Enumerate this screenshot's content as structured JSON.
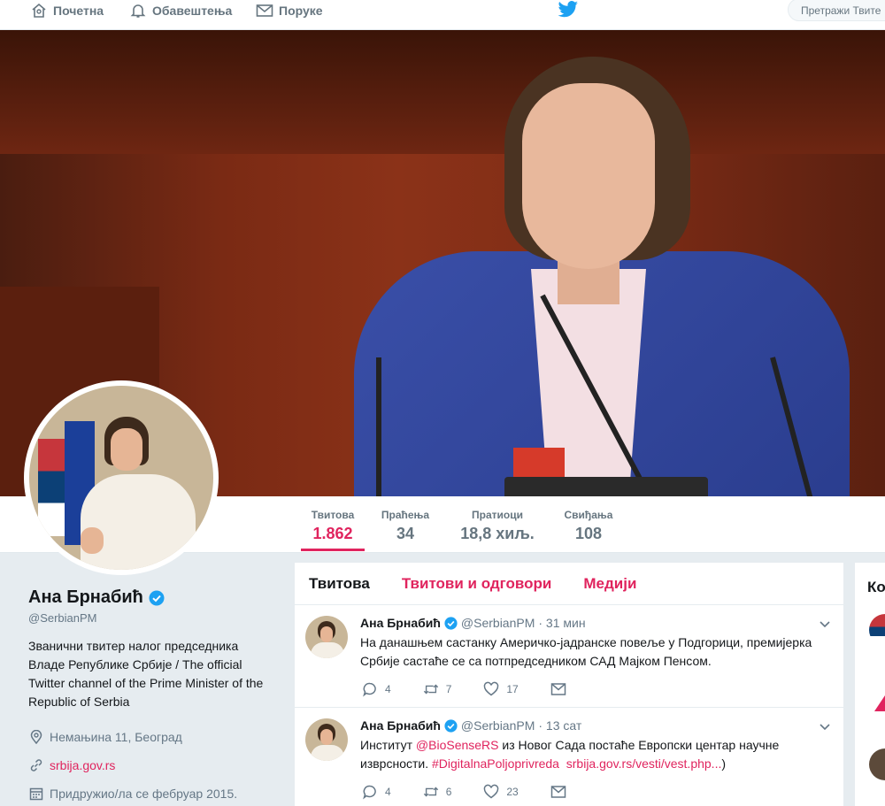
{
  "nav": {
    "home": "Почетна",
    "notifications": "Обавештења",
    "messages": "Поруке",
    "search_placeholder": "Претражи Твите"
  },
  "colors": {
    "accent": "#e0245e",
    "verified": "#1da1f2",
    "brand": "#1da1f2"
  },
  "stats": [
    {
      "label": "Твитова",
      "value": "1.862"
    },
    {
      "label": "Праћења",
      "value": "34"
    },
    {
      "label": "Пратиоци",
      "value": "18,8 хиљ."
    },
    {
      "label": "Свиђања",
      "value": "108"
    }
  ],
  "profile": {
    "name": "Ана Брнабић",
    "handle": "@SerbianPM",
    "bio": "Званични твитер налог председника Владе Републике Србије / The official Twitter channel of the Prime Minister of the Republic of Serbia",
    "location": "Немањина 11, Београд",
    "website": "srbija.gov.rs",
    "joined": "Придружио/ла се фебруар 2015."
  },
  "tabs": [
    "Твитова",
    "Твитови и одговори",
    "Медији"
  ],
  "tweets": [
    {
      "name": "Ана Брнабић",
      "handle": "@SerbianPM",
      "time": "· 31 мин",
      "text": "На данашњем састанку Америчко-јадранске повеље у Подгорици, премијерка Србије састаће се са потпредседником САД Мајком Пенсом.",
      "replies": "4",
      "retweets": "7",
      "likes": "17"
    },
    {
      "name": "Ана Брнабић",
      "handle": "@SerbianPM",
      "time": "· 13 сат",
      "text_before": "Институт ",
      "mention": "@BioSenseRS",
      "text_mid": " из Новог Сада постаће Европски центар научне изврсности. ",
      "hashtag": "#DigitalnaPoljoprivreda",
      "link": "srbija.gov.rs/vesti/vest.php...",
      "text_after": ")",
      "replies": "4",
      "retweets": "6",
      "likes": "23"
    }
  ],
  "right": {
    "title": "Ко"
  }
}
